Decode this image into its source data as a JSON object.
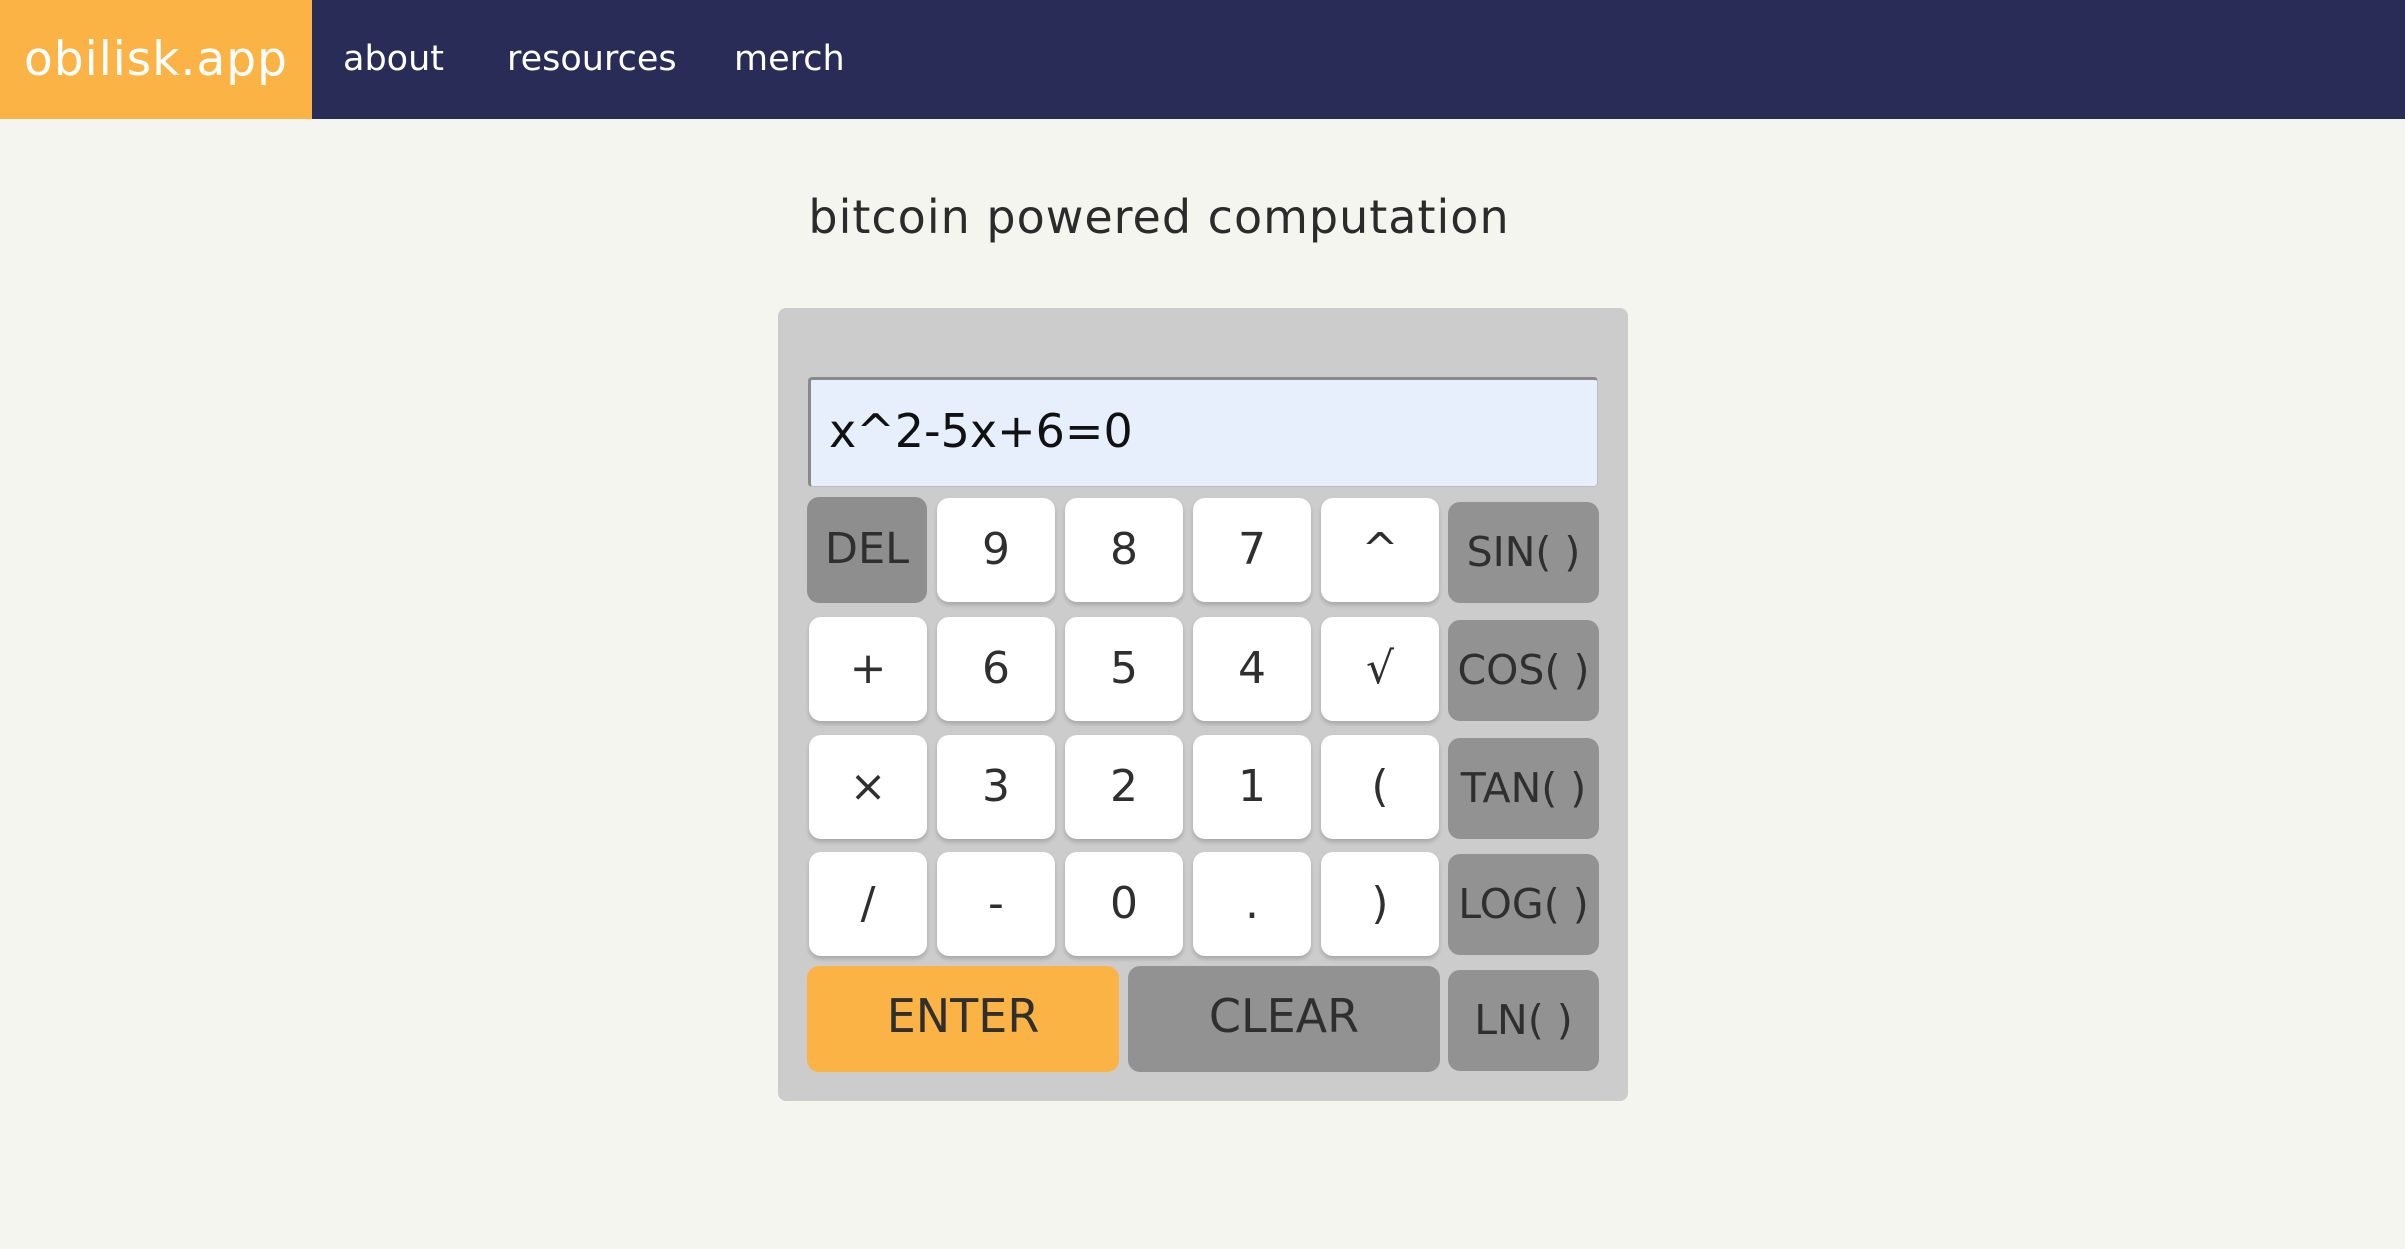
{
  "nav": {
    "brand": "obilisk.app",
    "links": [
      "about",
      "resources",
      "merch"
    ]
  },
  "page": {
    "headline": "bitcoin powered computation"
  },
  "calculator": {
    "display_value": "x^2-5x+6=0",
    "keys": {
      "del": "DEL",
      "seven": "7",
      "eight": "8",
      "nine": "9",
      "caret": "^",
      "plus": "+",
      "six": "6",
      "five": "5",
      "four": "4",
      "sqrt": "√",
      "times": "×",
      "three": "3",
      "two": "2",
      "one": "1",
      "lparen": "(",
      "divide": "/",
      "minus": "-",
      "zero": "0",
      "dot": ".",
      "rparen": ")",
      "enter": "ENTER",
      "clear": "CLEAR"
    },
    "functions": {
      "sin": "SIN( )",
      "cos": "COS( )",
      "tan": "TAN( )",
      "log": "LOG( )",
      "ln": "LN( )"
    }
  },
  "colors": {
    "nav_background": "#282c56",
    "brand_accent": "#fcb346",
    "page_background": "#f5f5ef",
    "calc_body": "#cccccc",
    "function_key": "#929292",
    "display_background": "#e8effc"
  }
}
